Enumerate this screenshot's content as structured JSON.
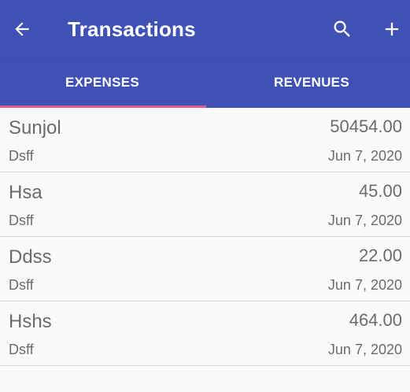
{
  "colors": {
    "appbar": "#3f51b5",
    "indicator": "#e05a8f",
    "text": "#6b6b6b"
  },
  "header": {
    "title": "Transactions",
    "icons": {
      "back": "arrow-left-icon",
      "search": "search-icon",
      "add": "plus-icon"
    }
  },
  "tabs": [
    {
      "label": "EXPENSES",
      "selected": true
    },
    {
      "label": "REVENUES",
      "selected": false
    }
  ],
  "transactions": [
    {
      "name": "Sunjol",
      "amount": "50454.00",
      "description": "Dsff",
      "date": "Jun 7, 2020"
    },
    {
      "name": "Hsa",
      "amount": "45.00",
      "description": "Dsff",
      "date": "Jun 7, 2020"
    },
    {
      "name": "Ddss",
      "amount": "22.00",
      "description": "Dsff",
      "date": "Jun 7, 2020"
    },
    {
      "name": "Hshs",
      "amount": "464.00",
      "description": "Dsff",
      "date": "Jun 7, 2020"
    }
  ]
}
